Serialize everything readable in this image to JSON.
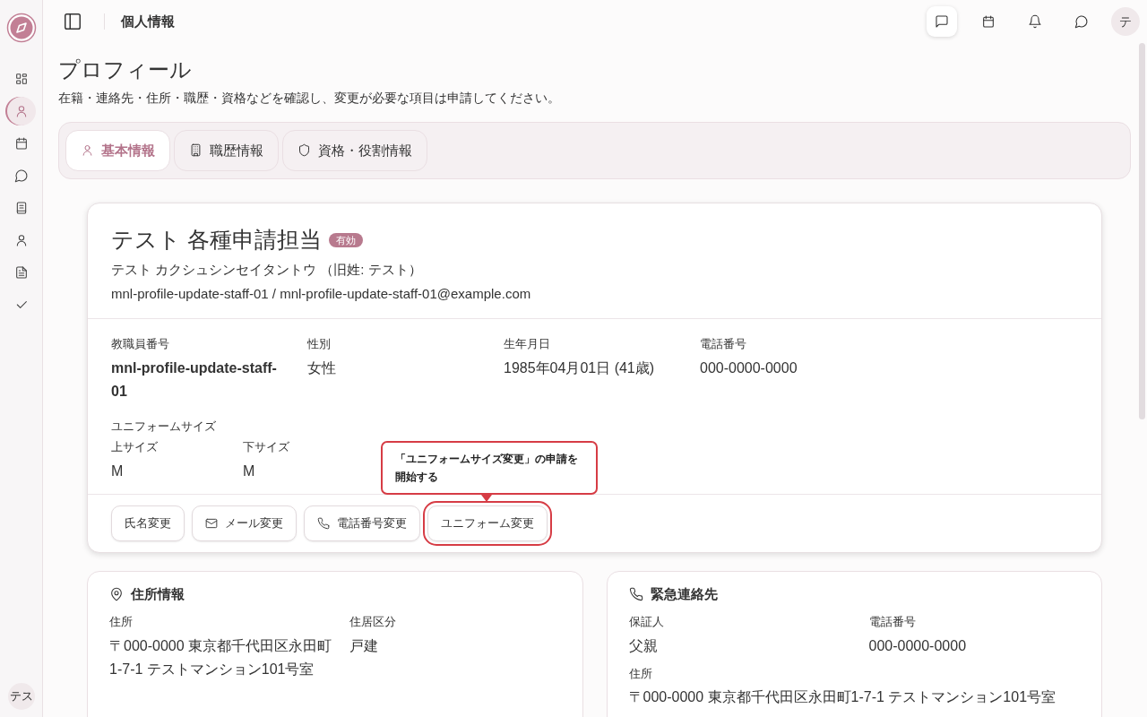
{
  "sidebar": {
    "items": [
      {
        "kind": "grid",
        "selected": false
      },
      {
        "kind": "user",
        "selected": true
      },
      {
        "kind": "calendar",
        "selected": false
      },
      {
        "kind": "chat",
        "selected": false
      },
      {
        "kind": "book",
        "selected": false
      },
      {
        "kind": "user",
        "selected": false
      },
      {
        "kind": "document",
        "selected": false
      },
      {
        "kind": "check",
        "selected": false
      }
    ],
    "avatar": "テス"
  },
  "topbar": {
    "title": "個人情報",
    "actions": [
      {
        "kind": "message",
        "selected": true
      },
      {
        "kind": "calendar",
        "selected": false
      },
      {
        "kind": "bell",
        "selected": false
      },
      {
        "kind": "chat",
        "selected": false
      }
    ],
    "avatar": "テ"
  },
  "page": {
    "title": "プロフィール",
    "description": "在籍・連絡先・住所・職歴・資格などを確認し、変更が必要な項目は申請してください。"
  },
  "tabs": [
    {
      "label": "基本情報",
      "kind": "user",
      "selected": true
    },
    {
      "label": "職歴情報",
      "kind": "building",
      "selected": false
    },
    {
      "label": "資格・役割情報",
      "kind": "shield",
      "selected": false
    }
  ],
  "profile": {
    "name": "テスト 各種申請担当",
    "status": "有効",
    "kana": "テスト カクシュシンセイタントウ （旧姓: テスト）",
    "account": "mnl-profile-update-staff-01 / mnl-profile-update-staff-01@example.com",
    "fields": [
      {
        "label": "教職員番号",
        "value": "mnl-profile-update-staff-01",
        "kind": "id"
      },
      {
        "label": "性別",
        "value": "女性",
        "kind": "text"
      },
      {
        "label": "生年月日",
        "value": "1985年04月01日 (41歳)",
        "kind": "text"
      },
      {
        "label": "電話番号",
        "value": "000-0000-0000",
        "kind": "text"
      }
    ],
    "uniform": {
      "title": "ユニフォームサイズ",
      "fields": [
        {
          "label": "上サイズ",
          "value": "M"
        },
        {
          "label": "下サイズ",
          "value": "M"
        }
      ]
    },
    "actions": [
      {
        "label": "氏名変更",
        "kind": "plain",
        "highlighted": false
      },
      {
        "label": "メール変更",
        "kind": "mail",
        "highlighted": false
      },
      {
        "label": "電話番号変更",
        "kind": "phone",
        "highlighted": false
      },
      {
        "label": "ユニフォーム変更",
        "kind": "plain",
        "highlighted": true,
        "tooltip": "「ユニフォームサイズ変更」の申請を開始する"
      }
    ]
  },
  "sections": [
    {
      "title": "住所情報",
      "kind": "pin",
      "fields": [
        {
          "label": "住所",
          "value": "〒000-0000 東京都千代田区永田町1-7-1 テストマンション101号室"
        },
        {
          "label": "住居区分",
          "value": "戸建"
        }
      ]
    },
    {
      "title": "緊急連絡先",
      "kind": "phone",
      "fields": [
        {
          "label": "保証人",
          "value": "父親"
        },
        {
          "label": "電話番号",
          "value": "000-0000-0000"
        },
        {
          "label": "住所",
          "value": "〒000-0000 東京都千代田区永田町1-7-1 テストマンション101号室"
        }
      ]
    }
  ]
}
